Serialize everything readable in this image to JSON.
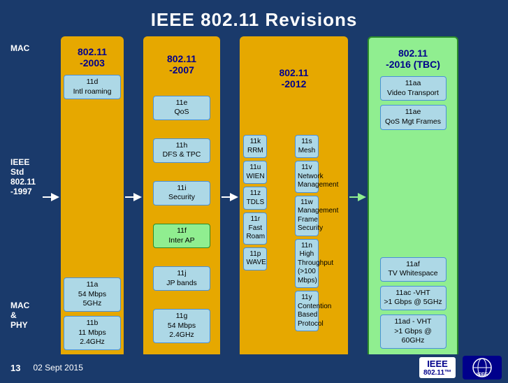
{
  "title": "IEEE 802.11 Revisions",
  "leftLabels": {
    "top": "MAC",
    "mid_label": "IEEE Std",
    "mid_std": "802.11",
    "mid_year": "-1997",
    "bottom1": "MAC",
    "bottom2": "&",
    "bottom3": "PHY"
  },
  "columns": [
    {
      "id": "col2003",
      "label": "802.11\n-2003",
      "boxes": [
        {
          "text": "11d\nIntl roaming"
        },
        {
          "text": "11a\n54 Mbps\n5GHz"
        },
        {
          "text": "11b\n11 Mbps\n2.4GHz"
        }
      ]
    },
    {
      "id": "col2007",
      "label": "802.11\n-2007",
      "boxes": [
        {
          "text": "11e\nQoS"
        },
        {
          "text": "11h\nDFS & TPC"
        },
        {
          "text": "11i\nSecurity"
        },
        {
          "text": "11f\nInter AP",
          "green": true
        },
        {
          "text": "11j\nJP bands"
        },
        {
          "text": "11g\n54 Mbps\n2.4GHz"
        }
      ]
    },
    {
      "id": "col2012",
      "label": "802.11\n-2012",
      "boxes_left": [
        {
          "text": "11k\nRRM"
        },
        {
          "text": "11u\nWIEN"
        },
        {
          "text": "11z\nTDLS"
        },
        {
          "text": "11r\nFast Roam"
        },
        {
          "text": "11p\nWAVE"
        }
      ],
      "boxes_right": [
        {
          "text": "11s\nMesh"
        },
        {
          "text": "11v\nNetwork\nManagement"
        },
        {
          "text": "11w\nManagement\nFrame\nSecurity"
        },
        {
          "text": "11n\nHigh\nThroughput\n(>100 Mbps)"
        },
        {
          "text": "11y\nContention\nBased\nProtocol"
        }
      ]
    },
    {
      "id": "col2016",
      "label": "802.11\n-2016 (TBC)",
      "boxes": [
        {
          "text": "11aa\nVideo Transport"
        },
        {
          "text": "11ae\nQoS Mgt Frames"
        },
        {
          "text": "11af\nTV Whitespace"
        },
        {
          "text": "11ac -VHT\n>1 Gbps @ 5GHz"
        },
        {
          "text": "11ad - VHT\n>1 Gbps @ 60GHz"
        }
      ]
    }
  ],
  "footer": {
    "number": "13",
    "date": "02 Sept 2015"
  }
}
